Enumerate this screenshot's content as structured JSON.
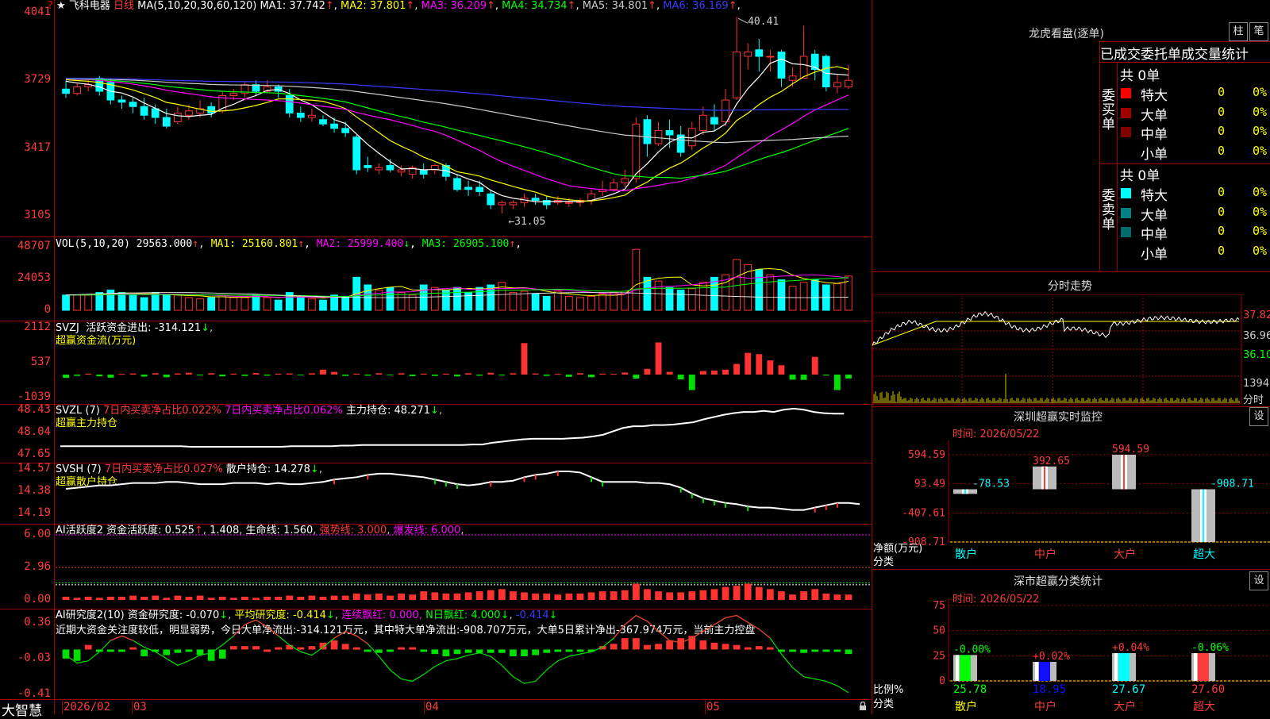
{
  "window": {
    "corner_icon": "?",
    "brand": "大智慧"
  },
  "kline": {
    "star": "★",
    "stock_name": "飞科电器",
    "period": "日线",
    "ma_params": "MA(5,10,20,30,60,120)",
    "ma": [
      {
        "label": "MA1:",
        "value": "37.742",
        "arrow": "↑",
        "color": "#ffffff"
      },
      {
        "label": "MA2:",
        "value": "37.801",
        "arrow": "↑",
        "color": "#ffff00"
      },
      {
        "label": "MA3:",
        "value": "36.209",
        "arrow": "↑",
        "color": "#ff00ff"
      },
      {
        "label": "MA4:",
        "value": "34.734",
        "arrow": "↑",
        "color": "#00ff00"
      },
      {
        "label": "MA5:",
        "value": "34.801",
        "arrow": "↑",
        "color": "#cccccc"
      },
      {
        "label": "MA6:",
        "value": "36.169",
        "arrow": "↑",
        "color": "#3a3aff"
      }
    ],
    "yticks": [
      "4041",
      "3729",
      "3417",
      "3105"
    ],
    "high_label": "40.41",
    "low_label": "31.05",
    "candles": [
      [
        37.1,
        36.9,
        37.5,
        36.7
      ],
      [
        36.9,
        37.2,
        37.4,
        36.8
      ],
      [
        37.2,
        37.3,
        37.6,
        37.0
      ],
      [
        37.6,
        37.0,
        37.7,
        36.8
      ],
      [
        37.4,
        36.6,
        37.6,
        36.4
      ],
      [
        36.6,
        36.5,
        36.8,
        36.2
      ],
      [
        36.5,
        36.3,
        36.7,
        36.0
      ],
      [
        36.3,
        35.9,
        36.7,
        35.7
      ],
      [
        36.2,
        35.8,
        36.4,
        35.5
      ],
      [
        35.8,
        35.4,
        36.2,
        35.3
      ],
      [
        35.6,
        36.0,
        36.3,
        35.5
      ],
      [
        35.9,
        36.1,
        36.4,
        35.7
      ],
      [
        36.0,
        36.2,
        36.6,
        35.8
      ],
      [
        36.3,
        36.0,
        36.5,
        35.8
      ],
      [
        36.1,
        36.8,
        37.0,
        36.0
      ],
      [
        36.8,
        36.9,
        37.1,
        36.6
      ],
      [
        36.9,
        37.3,
        37.4,
        36.7
      ],
      [
        37.3,
        37.0,
        37.5,
        36.8
      ],
      [
        37.0,
        37.2,
        37.5,
        36.9
      ],
      [
        37.2,
        37.0,
        37.3,
        36.7
      ],
      [
        36.8,
        36.0,
        37.1,
        35.8
      ],
      [
        36.0,
        35.8,
        36.3,
        35.6
      ],
      [
        35.8,
        35.9,
        36.2,
        35.6
      ],
      [
        35.7,
        35.5,
        35.9,
        35.4
      ],
      [
        35.5,
        35.3,
        35.8,
        35.1
      ],
      [
        35.3,
        35.1,
        35.6,
        34.9
      ],
      [
        34.9,
        33.4,
        35.0,
        33.2
      ],
      [
        33.6,
        33.5,
        34.0,
        33.3
      ],
      [
        33.4,
        33.5,
        33.7,
        33.2
      ],
      [
        33.6,
        33.4,
        33.9,
        33.3
      ],
      [
        33.3,
        33.4,
        33.6,
        33.1
      ],
      [
        33.2,
        33.5,
        33.6,
        33.0
      ],
      [
        33.4,
        33.2,
        33.7,
        33.0
      ],
      [
        33.4,
        33.6,
        33.7,
        33.2
      ],
      [
        33.6,
        33.1,
        33.7,
        32.9
      ],
      [
        33.0,
        32.5,
        33.2,
        32.4
      ],
      [
        32.6,
        32.5,
        32.9,
        32.2
      ],
      [
        32.6,
        32.4,
        32.9,
        32.2
      ],
      [
        32.3,
        31.8,
        32.5,
        31.6
      ],
      [
        31.8,
        31.9,
        32.0,
        31.4
      ],
      [
        31.8,
        31.9,
        32.0,
        31.6
      ],
      [
        31.9,
        32.1,
        32.3,
        31.7
      ],
      [
        32.1,
        32.0,
        32.3,
        31.8
      ],
      [
        32.0,
        31.8,
        32.2,
        31.6
      ],
      [
        31.9,
        32.0,
        32.2,
        31.8
      ],
      [
        31.9,
        31.9,
        32.1,
        31.7
      ],
      [
        31.9,
        32.0,
        32.1,
        31.7
      ],
      [
        32.0,
        32.3,
        32.5,
        31.8
      ],
      [
        32.4,
        32.5,
        32.9,
        32.2
      ],
      [
        32.5,
        32.8,
        33.0,
        32.4
      ],
      [
        32.8,
        33.0,
        33.4,
        32.6
      ],
      [
        33.0,
        35.5,
        35.8,
        32.8
      ],
      [
        35.7,
        34.6,
        35.9,
        34.0
      ],
      [
        34.6,
        35.2,
        35.6,
        34.5
      ],
      [
        35.2,
        35.0,
        35.7,
        34.4
      ],
      [
        35.0,
        34.2,
        35.4,
        34.0
      ],
      [
        34.5,
        35.3,
        35.6,
        34.3
      ],
      [
        35.2,
        35.9,
        36.3,
        35.0
      ],
      [
        35.8,
        35.5,
        36.4,
        35.2
      ],
      [
        35.6,
        36.6,
        37.1,
        35.4
      ],
      [
        36.7,
        38.8,
        40.41,
        36.6
      ],
      [
        38.6,
        38.8,
        39.2,
        38.0
      ],
      [
        38.9,
        38.6,
        39.4,
        37.9
      ],
      [
        38.6,
        38.6,
        38.9,
        37.9
      ],
      [
        38.8,
        37.6,
        38.9,
        37.2
      ],
      [
        37.5,
        37.7,
        38.1,
        37.2
      ],
      [
        37.6,
        38.6,
        40.0,
        37.6
      ],
      [
        38.7,
        38.0,
        38.9,
        37.5
      ],
      [
        38.6,
        37.2,
        38.7,
        37.0
      ],
      [
        37.2,
        37.4,
        37.8,
        36.9
      ],
      [
        37.2,
        37.5,
        38.2,
        37.1
      ]
    ]
  },
  "vol": {
    "params": "VOL(5,10,20)",
    "value": "29563.000",
    "arrow": "↑",
    "ma": [
      {
        "label": "MA1:",
        "value": "25160.801",
        "arrow": "↑",
        "color": "#ffff00"
      },
      {
        "label": "MA2:",
        "value": "25999.400",
        "arrow": "↓",
        "color": "#ff00ff"
      },
      {
        "label": "MA3:",
        "value": "26905.100",
        "arrow": "↑",
        "color": "#00ff00"
      }
    ],
    "yticks": [
      "48707",
      "24053",
      "0"
    ],
    "bars": [
      12,
      12,
      12,
      14,
      16,
      14,
      12,
      10,
      14,
      12,
      12,
      10,
      9,
      10,
      12,
      10,
      10,
      12,
      10,
      8,
      14,
      10,
      9,
      8,
      12,
      11,
      26,
      20,
      16,
      18,
      14,
      12,
      20,
      18,
      16,
      18,
      14,
      18,
      20,
      22,
      14,
      15,
      13,
      11,
      15,
      11,
      10,
      11,
      13,
      14,
      15,
      48,
      26,
      23,
      18,
      16,
      17,
      22,
      26,
      28,
      40,
      36,
      32,
      28,
      24,
      19,
      22,
      24,
      20,
      21,
      27
    ]
  },
  "svzj": {
    "name": "SVZJ",
    "label": "活跃资金进出:",
    "value": "-314.121",
    "arrow": "↓",
    "subtitle": "超赢资金流(万元)",
    "yticks": [
      "2112",
      "537",
      "-1039"
    ],
    "bars": [
      -150,
      -60,
      40,
      -80,
      -140,
      30,
      50,
      -90,
      60,
      -120,
      50,
      80,
      -40,
      60,
      -80,
      40,
      -60,
      70,
      -50,
      40,
      50,
      -30,
      60,
      220,
      120,
      -60,
      40,
      -50,
      60,
      -30,
      60,
      -70,
      40,
      -60,
      40,
      -80,
      60,
      -50,
      80,
      -40,
      60,
      1420,
      50,
      -60,
      30,
      -100,
      60,
      -120,
      40,
      30,
      90,
      -180,
      260,
      1450,
      120,
      -220,
      -700,
      160,
      180,
      220,
      480,
      980,
      920,
      640,
      420,
      -230,
      -240,
      800,
      -40,
      -700,
      -180
    ]
  },
  "svzl": {
    "name": "SVZL",
    "params": "(7)",
    "t1": "7日内买卖净占比",
    "v1": "0.022%",
    "t2": "7日内买卖净占比",
    "v2": "0.062%",
    "label3": "主力持仓:",
    "value": "48.271",
    "arrow": "↓",
    "subtitle": "超赢主力持仓",
    "yticks": [
      "48.43",
      "48.04",
      "47.65"
    ],
    "line": [
      47.8,
      47.8,
      47.8,
      47.8,
      47.8,
      47.8,
      47.8,
      47.8,
      47.8,
      47.8,
      47.8,
      47.8,
      47.8,
      47.79,
      47.79,
      47.79,
      47.79,
      47.79,
      47.79,
      47.79,
      47.79,
      47.79,
      47.79,
      47.8,
      47.8,
      47.8,
      47.8,
      47.8,
      47.81,
      47.81,
      47.82,
      47.82,
      47.82,
      47.82,
      47.82,
      47.82,
      47.82,
      47.82,
      47.82,
      47.82,
      47.82,
      47.83,
      47.83,
      47.86,
      47.88,
      47.9,
      47.92,
      47.93,
      47.93,
      47.93,
      47.93,
      47.94,
      47.95,
      47.97,
      48.0,
      48.06,
      48.12,
      48.15,
      48.15,
      48.17,
      48.17,
      48.18,
      48.2,
      48.22,
      48.27,
      48.31,
      48.35,
      48.38,
      48.4,
      48.4,
      48.42,
      48.4,
      48.44,
      48.46,
      48.44,
      48.4,
      48.38,
      48.37,
      48.37
    ]
  },
  "svsh": {
    "name": "SVSH",
    "params": "(7)",
    "t1": "7日内买卖净占比",
    "v1": "0.027%",
    "label2": "散户持仓:",
    "value": "14.278",
    "arrow": "↓",
    "subtitle": "超赢散户持仓",
    "yticks": [
      "14.57",
      "14.38",
      "14.19"
    ],
    "line": [
      14.4,
      14.41,
      14.42,
      14.43,
      14.43,
      14.44,
      14.45,
      14.45,
      14.45,
      14.46,
      14.46,
      14.45,
      14.44,
      14.44,
      14.44,
      14.45,
      14.45,
      14.45,
      14.44,
      14.45,
      14.44,
      14.44,
      14.45,
      14.46,
      14.48,
      14.49,
      14.5,
      14.52,
      14.53,
      14.53,
      14.52,
      14.51,
      14.5,
      14.48,
      14.46,
      14.44,
      14.43,
      14.44,
      14.46,
      14.46,
      14.47,
      14.5,
      14.52,
      14.53,
      14.55,
      14.55,
      14.54,
      14.5,
      14.46,
      14.46,
      14.46,
      14.46,
      14.45,
      14.45,
      14.44,
      14.41,
      14.36,
      14.32,
      14.3,
      14.28,
      14.27,
      14.25,
      14.24,
      14.24,
      14.23,
      14.22,
      14.22,
      14.24,
      14.26,
      14.28,
      14.28,
      14.27
    ]
  },
  "ai1": {
    "name": "AI活跃度2",
    "label": "资金活跃度:",
    "value": "0.525",
    "arrow": "↑",
    "v2": "1.408",
    "l3": "生命线:",
    "v3": "1.560",
    "l4": "强势线:",
    "v4": "3.000",
    "l5": "爆发线:",
    "v5": "6.000",
    "yticks": [
      "6.00",
      "2.96",
      "0.00"
    ],
    "bars": [
      0.3,
      0.2,
      0.3,
      0.2,
      0.3,
      0.3,
      0.4,
      0.3,
      0.4,
      0.2,
      0.4,
      0.3,
      0.4,
      0.2,
      0.3,
      0.2,
      0.3,
      0.2,
      0.3,
      0.3,
      0.4,
      0.3,
      0.4,
      0.3,
      0.4,
      0.4,
      0.6,
      0.5,
      0.6,
      0.4,
      0.6,
      0.5,
      0.8,
      0.7,
      0.6,
      0.6,
      0.7,
      0.8,
      0.9,
      1.0,
      0.8,
      0.7,
      0.6,
      0.6,
      0.5,
      0.6,
      0.6,
      0.7,
      0.8,
      0.8,
      0.9,
      1.5,
      1.0,
      0.8,
      0.7,
      0.7,
      0.8,
      0.9,
      1.0,
      1.2,
      1.3,
      1.5,
      1.2,
      1.0,
      0.8,
      0.5,
      0.8,
      1.0,
      0.6,
      0.5,
      0.5
    ]
  },
  "ai2": {
    "name": "AI研究度2(10)",
    "label": "资金研究度:",
    "value": "-0.070",
    "arrow": "↓",
    "l2": "平均研究度:",
    "v2": "-0.414",
    "a2": "↓",
    "l3": "连续飘红:",
    "v3": "0.000,",
    "l4": "N日飘红:",
    "v4": "4.000",
    "a4": "↓",
    "v5": "-0.414",
    "a5": "↓",
    "message": "近期大资金关注度较低，明显弱势，今日大单净流出:-314.121万元，其中特大单净流出:-908.707万元，大单5日累计净出-367.974万元，当前主力控盘",
    "yticks": [
      "0.36",
      "-0.03",
      "-0.41"
    ],
    "bars": [
      -0.08,
      -0.1,
      0.04,
      -0.02,
      -0.02,
      -0.01,
      0.02,
      -0.06,
      -0.02,
      -0.05,
      -0.03,
      -0.02,
      -0.05,
      -0.1,
      -0.08,
      0.03,
      0.03,
      0.03,
      0.0,
      0.02,
      0.04,
      0.02,
      0.03,
      0.06,
      0.08,
      0.05,
      0.02,
      -0.02,
      -0.03,
      -0.02,
      0.02,
      0.02,
      -0.02,
      -0.04,
      -0.06,
      -0.04,
      -0.03,
      -0.03,
      -0.03,
      -0.03,
      -0.06,
      -0.06,
      -0.05,
      -0.03,
      -0.02,
      -0.02,
      -0.02,
      -0.02,
      0.03,
      0.05,
      0.1,
      0.1,
      0.04,
      0.05,
      0.08,
      0.1,
      0.12,
      0.08,
      0.06,
      0.05,
      0.04,
      0.02,
      0.03,
      0.02,
      -0.02,
      -0.02,
      -0.03,
      -0.02,
      -0.02,
      -0.02,
      -0.04
    ],
    "line": [
      -0.05,
      -0.12,
      -0.1,
      -0.02,
      0.08,
      0.12,
      0.08,
      0.02,
      -0.02,
      -0.08,
      -0.14,
      -0.1,
      -0.05,
      -0.03,
      0.04,
      0.12,
      0.22,
      0.26,
      0.2,
      0.12,
      0.04,
      -0.02,
      -0.05,
      0.02,
      0.1,
      0.16,
      0.12,
      0.05,
      -0.06,
      -0.18,
      -0.26,
      -0.28,
      -0.22,
      -0.15,
      -0.1,
      -0.08,
      -0.05,
      -0.03,
      -0.06,
      -0.14,
      -0.24,
      -0.3,
      -0.28,
      -0.18,
      -0.1,
      -0.06,
      -0.04,
      -0.02,
      0.02,
      0.1,
      0.22,
      0.3,
      0.25,
      0.16,
      0.08,
      0.06,
      0.1,
      0.16,
      0.22,
      0.28,
      0.3,
      0.24,
      0.18,
      0.1,
      -0.04,
      -0.16,
      -0.24,
      -0.26,
      -0.28,
      -0.32,
      -0.38
    ]
  },
  "xaxis": {
    "labels": [
      "2026/02",
      "03",
      "04",
      "05"
    ]
  },
  "right": {
    "tabs": [
      "柱",
      "笔"
    ],
    "lhb_title": "龙虎看盘(逐单)",
    "stat_heads": [
      "已成交",
      "委托单",
      "成交量",
      "统计"
    ],
    "buy_label": "委买单",
    "sell_label": "委卖单",
    "buy_total": "共 0单",
    "sell_total": "共 0单",
    "buy_rows": [
      {
        "name": "特大",
        "count": "0",
        "pct": "0%",
        "color": "#ff0000"
      },
      {
        "name": "大单",
        "count": "0",
        "pct": "0%",
        "color": "#a00000"
      },
      {
        "name": "中单",
        "count": "0",
        "pct": "0%",
        "color": "#800000"
      },
      {
        "name": "小单",
        "count": "0",
        "pct": "0%",
        "color": ""
      }
    ],
    "sell_rows": [
      {
        "name": "特大",
        "count": "0",
        "pct": "0%",
        "color": "#00ffff"
      },
      {
        "name": "大单",
        "count": "0",
        "pct": "0%",
        "color": "#008080"
      },
      {
        "name": "中单",
        "count": "0",
        "pct": "0%",
        "color": "#006b6b"
      },
      {
        "name": "小单",
        "count": "0",
        "pct": "0%",
        "color": ""
      }
    ],
    "ts_title": "分时走势",
    "ts_ylabels": [
      "37.82",
      "36.96",
      "36.10",
      "1394",
      "分时"
    ],
    "sz_title": "深圳超赢实时监控",
    "sz_set": "设",
    "sz_time": "时间: 2026/05/22",
    "sz_yticks": [
      "594.59",
      "93.49",
      "-407.61",
      "-908.71"
    ],
    "sz_net": "净额(万元)",
    "sz_cat": "分类",
    "sz_bars": [
      {
        "label": "散户",
        "value": -78.53,
        "text": "-78.53",
        "color": "#00ffff"
      },
      {
        "label": "中户",
        "value": 392.65,
        "text": "392.65",
        "color": "#ff3b3b"
      },
      {
        "label": "大户",
        "value": 594.59,
        "text": "594.59",
        "color": "#ff3b3b"
      },
      {
        "label": "超大",
        "value": -908.71,
        "text": "-908.71",
        "color": "#00ffff"
      }
    ],
    "cls_title": "深市超赢分类统计",
    "cls_set": "设",
    "cls_time": "时间: 2026/05/22",
    "cls_yticks": [
      "75",
      "50",
      "25",
      "0"
    ],
    "cls_ratio": "比例%",
    "cls_cat": "分类",
    "cls_bars": [
      {
        "label": "散户",
        "value": 25.78,
        "text": "25.78",
        "change": "-0.00%",
        "color": "#00ff00",
        "chg_color": "#00ff00"
      },
      {
        "label": "中户",
        "value": 18.95,
        "text": "18.95",
        "change": "+0.02%",
        "color": "#1010ff",
        "chg_color": "#ff3b3b"
      },
      {
        "label": "大户",
        "value": 27.67,
        "text": "27.67",
        "change": "+0.04%",
        "color": "#00ffff",
        "chg_color": "#ff3b3b"
      },
      {
        "label": "超大",
        "value": 27.6,
        "text": "27.60",
        "change": "-0.06%",
        "color": "#ff3b3b",
        "chg_color": "#00ff00"
      }
    ],
    "cls_val_colors": [
      "#00ff00",
      "#1010ff",
      "#00ffff",
      "#ff3b3b"
    ],
    "cls_label_colors": [
      "#ffff00",
      "#ff3b3b",
      "#ff3b3b",
      "#ff3b3b"
    ]
  },
  "colors": {
    "up": "#ff3232",
    "down": "#00ffff",
    "grid": "#a00000",
    "axis": "#ff3b3b"
  }
}
